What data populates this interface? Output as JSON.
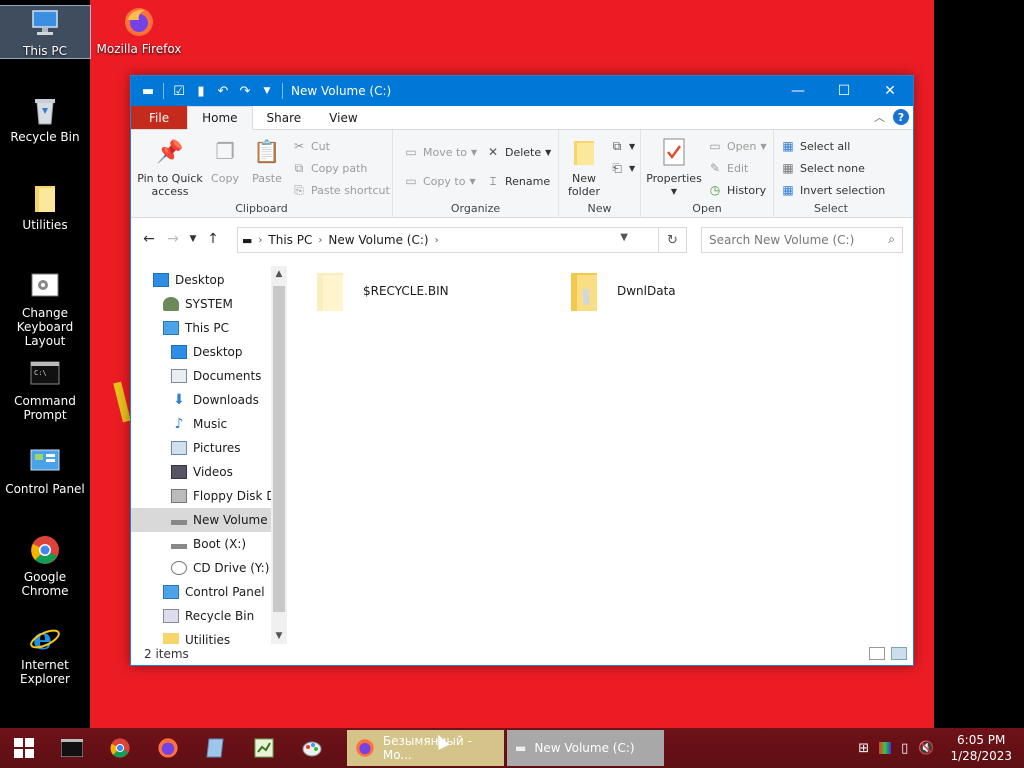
{
  "desktop": {
    "icons": [
      {
        "label": "This PC"
      },
      {
        "label": "Mozilla Firefox"
      },
      {
        "label": "Recycle Bin"
      },
      {
        "label": "Utilities"
      },
      {
        "label": "Change Keyboard Layout"
      },
      {
        "label": "Command Prompt"
      },
      {
        "label": "Control Panel"
      },
      {
        "label": "Google Chrome"
      },
      {
        "label": "Internet Explorer"
      }
    ]
  },
  "window": {
    "title": "New Volume (C:)",
    "tabs": [
      "File",
      "Home",
      "Share",
      "View"
    ],
    "ribbon": {
      "clipboard": {
        "label": "Clipboard",
        "pin": "Pin to Quick access",
        "copy": "Copy",
        "paste": "Paste",
        "cut": "Cut",
        "copy_path": "Copy path",
        "paste_shortcut": "Paste shortcut"
      },
      "organize": {
        "label": "Organize",
        "move_to": "Move to",
        "copy_to": "Copy to",
        "delete": "Delete",
        "rename": "Rename"
      },
      "new": {
        "label": "New",
        "new_folder": "New folder"
      },
      "open": {
        "label": "Open",
        "properties": "Properties",
        "open": "Open",
        "edit": "Edit",
        "history": "History"
      },
      "select": {
        "label": "Select",
        "select_all": "Select all",
        "select_none": "Select none",
        "invert": "Invert selection"
      }
    },
    "address": {
      "crumbs": [
        "This PC",
        "New Volume (C:)"
      ],
      "search_placeholder": "Search New Volume (C:)"
    },
    "nav": [
      "Desktop",
      "SYSTEM",
      "This PC",
      "Desktop",
      "Documents",
      "Downloads",
      "Music",
      "Pictures",
      "Videos",
      "Floppy Disk Dri",
      "New Volume (C",
      "Boot (X:)",
      "CD Drive (Y:) H",
      "Control Panel",
      "Recycle Bin",
      "Utilities"
    ],
    "files": [
      {
        "name": "$RECYCLE.BIN"
      },
      {
        "name": "DwnlData"
      }
    ],
    "status": "2 items"
  },
  "taskbar": {
    "tasks": [
      {
        "label": "Безымянный - Mo..."
      },
      {
        "label": "New Volume (C:)"
      }
    ],
    "time": "6:05 PM",
    "date": "1/28/2023"
  },
  "colors": {
    "accent": "#0078d7",
    "file_tab": "#c42b1c",
    "wallpaper": "#ec1c24",
    "taskbar": "#6e1218"
  }
}
